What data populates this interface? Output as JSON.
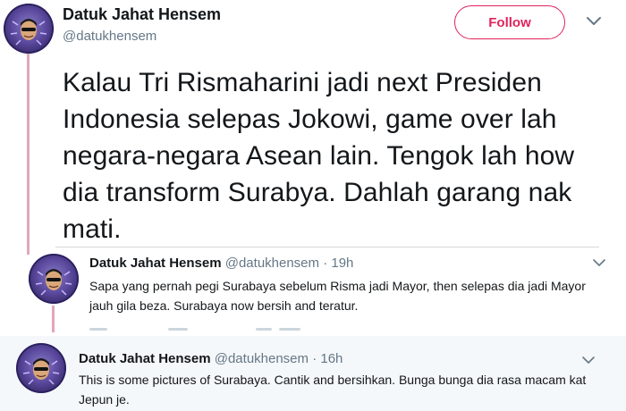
{
  "main_tweet": {
    "display_name": "Datuk Jahat Hensem",
    "handle": "@datukhensem",
    "follow_label": "Follow",
    "text": "Kalau Tri Rismaharini jadi next Presiden Indonesia selepas Jokowi, game over lah negara-negara Asean lain. Tengok lah how dia transform Surabya. Dahlah garang nak mati."
  },
  "replies": [
    {
      "display_name": "Datuk Jahat Hensem",
      "meta": "@datukhensem · 19h",
      "text": "Sapa yang pernah pegi Surabaya sebelum Risma jadi Mayor, then selepas dia jadi Mayor jauh gila beza. Surabaya now bersih and teratur."
    },
    {
      "display_name": "Datuk Jahat Hensem",
      "meta": "@datukhensem · 16h",
      "text": "This is some pictures of Surabaya. Cantik and bersihkan. Bunga bunga dia rasa macam kat Jepun je."
    }
  ],
  "icons": {
    "more": "chevron-down-icon",
    "avatar": "profile-avatar"
  },
  "colors": {
    "accent": "#e0245e",
    "thread_line": "#e2a7b9",
    "muted_text": "#657786",
    "highlight_bg": "#f5f8fa"
  }
}
